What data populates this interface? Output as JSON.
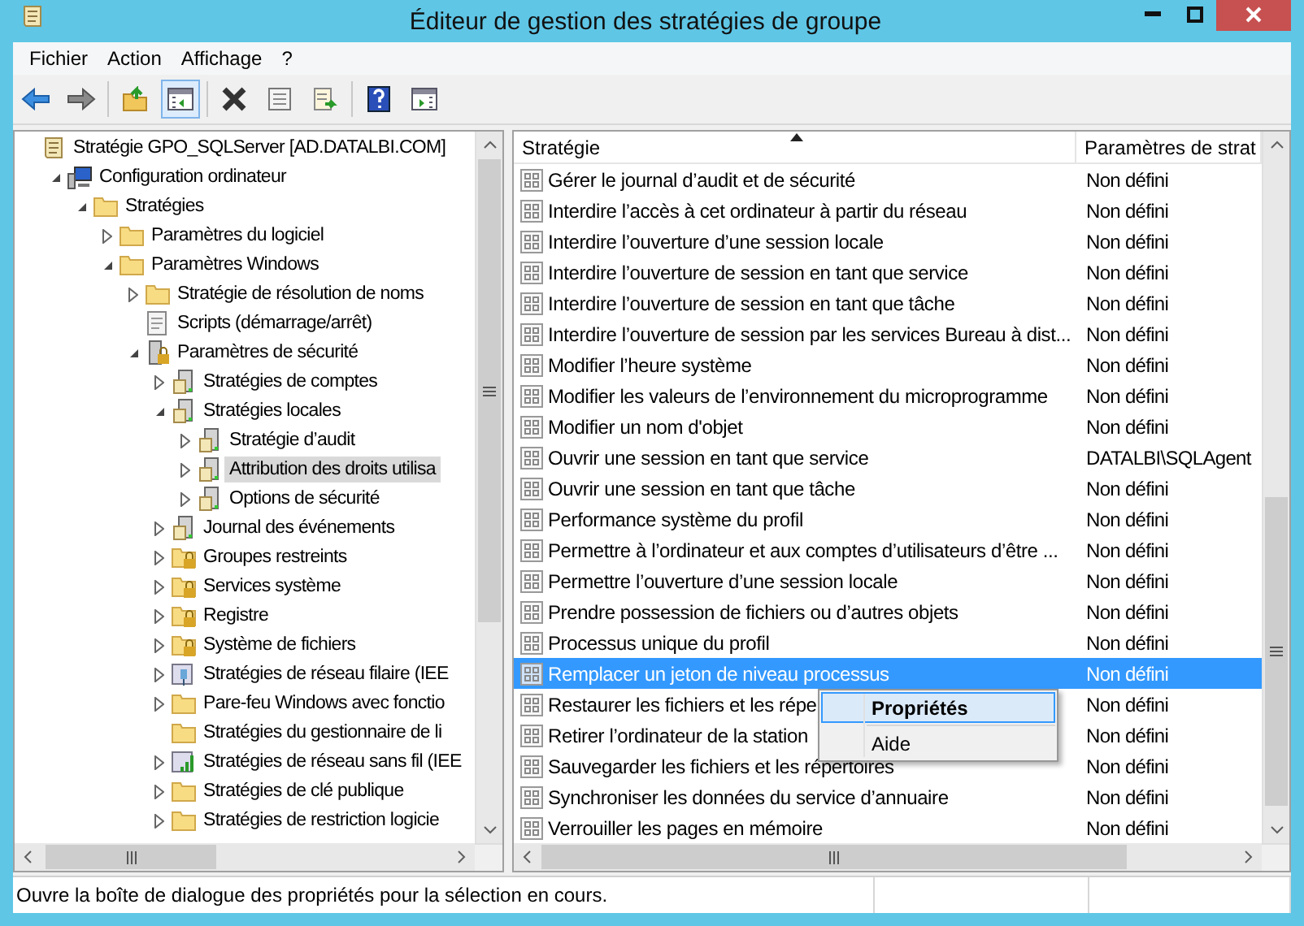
{
  "window": {
    "title": "Éditeur de gestion des stratégies de groupe"
  },
  "menu": [
    "Fichier",
    "Action",
    "Affichage",
    "?"
  ],
  "toolbar": [
    {
      "kind": "back"
    },
    {
      "kind": "forward"
    },
    {
      "kind": "sep"
    },
    {
      "kind": "up"
    },
    {
      "kind": "tree",
      "selected": true
    },
    {
      "kind": "sep"
    },
    {
      "kind": "delete"
    },
    {
      "kind": "properties"
    },
    {
      "kind": "export"
    },
    {
      "kind": "sep"
    },
    {
      "kind": "help"
    },
    {
      "kind": "pane",
      "selected": false
    }
  ],
  "tree": [
    {
      "label": "Stratégie GPO_SQLServer [AD.DATALBI.COM]",
      "kind": "scroll",
      "selected": false,
      "children": [
        {
          "label": "Configuration ordinateur",
          "kind": "computer",
          "expanded": true,
          "selected": false,
          "children": [
            {
              "label": "Stratégies",
              "kind": "folder",
              "expanded": true,
              "selected": false,
              "children": [
                {
                  "label": "Paramètres du logiciel",
                  "kind": "folder",
                  "expanded": false,
                  "selected": false
                },
                {
                  "label": "Paramètres Windows",
                  "kind": "folder",
                  "expanded": true,
                  "selected": false,
                  "children": [
                    {
                      "label": "Stratégie de résolution de noms",
                      "kind": "folder",
                      "expanded": false,
                      "selected": false
                    },
                    {
                      "label": "Scripts (démarrage/arrêt)",
                      "kind": "script",
                      "selected": false
                    },
                    {
                      "label": "Paramètres de sécurité",
                      "kind": "lockserver",
                      "expanded": true,
                      "selected": false,
                      "children": [
                        {
                          "label": "Stratégies de comptes",
                          "kind": "server",
                          "expanded": false,
                          "selected": false
                        },
                        {
                          "label": "Stratégies locales",
                          "kind": "server",
                          "expanded": true,
                          "selected": false,
                          "children": [
                            {
                              "label": "Stratégie d’audit",
                              "kind": "server",
                              "expanded": false,
                              "selected": false
                            },
                            {
                              "label": "Attribution des droits utilisa",
                              "kind": "server",
                              "expanded": false,
                              "selected": true
                            },
                            {
                              "label": "Options de sécurité",
                              "kind": "server",
                              "expanded": false,
                              "selected": false
                            }
                          ]
                        },
                        {
                          "label": "Journal des événements",
                          "kind": "server",
                          "expanded": false,
                          "selected": false
                        },
                        {
                          "label": "Groupes restreints",
                          "kind": "lockfolder",
                          "expanded": false,
                          "selected": false
                        },
                        {
                          "label": "Services système",
                          "kind": "lockfolder",
                          "expanded": false,
                          "selected": false
                        },
                        {
                          "label": "Registre",
                          "kind": "lockfolder",
                          "expanded": false,
                          "selected": false
                        },
                        {
                          "label": "Système de fichiers",
                          "kind": "lockfolder",
                          "expanded": false,
                          "selected": false
                        },
                        {
                          "label": "Stratégies de réseau filaire (IEE",
                          "kind": "network",
                          "expanded": false,
                          "selected": false
                        },
                        {
                          "label": "Pare-feu Windows avec fonctio",
                          "kind": "folder",
                          "expanded": false,
                          "selected": false
                        },
                        {
                          "label": "Stratégies du gestionnaire de li",
                          "kind": "folder",
                          "selected": false
                        },
                        {
                          "label": "Stratégies de réseau sans fil (IEE",
                          "kind": "wireless",
                          "expanded": false,
                          "selected": false
                        },
                        {
                          "label": "Stratégies de clé publique",
                          "kind": "folder",
                          "expanded": false,
                          "selected": false
                        },
                        {
                          "label": "Stratégies de restriction logicie",
                          "kind": "folder",
                          "expanded": false,
                          "selected": false
                        }
                      ]
                    }
                  ]
                }
              ]
            }
          ]
        }
      ]
    }
  ],
  "list": {
    "columns": [
      "Stratégie",
      "Paramètres de strat"
    ],
    "rows": [
      {
        "policy": "Gérer le journal d’audit et de sécurité",
        "setting": "Non défini",
        "selected": false
      },
      {
        "policy": "Interdire l’accès à cet ordinateur à partir du réseau",
        "setting": "Non défini",
        "selected": false
      },
      {
        "policy": "Interdire l’ouverture d’une session locale",
        "setting": "Non défini",
        "selected": false
      },
      {
        "policy": "Interdire l’ouverture de session en tant que service",
        "setting": "Non défini",
        "selected": false
      },
      {
        "policy": "Interdire l’ouverture de session en tant que tâche",
        "setting": "Non défini",
        "selected": false
      },
      {
        "policy": "Interdire l’ouverture de session par les services Bureau à dist...",
        "setting": "Non défini",
        "selected": false
      },
      {
        "policy": "Modifier l’heure système",
        "setting": "Non défini",
        "selected": false
      },
      {
        "policy": "Modifier les valeurs de l’environnement du microprogramme",
        "setting": "Non défini",
        "selected": false
      },
      {
        "policy": "Modifier un nom d'objet",
        "setting": "Non défini",
        "selected": false
      },
      {
        "policy": "Ouvrir une session en tant que service",
        "setting": "DATALBI\\SQLAgent",
        "selected": false
      },
      {
        "policy": "Ouvrir une session en tant que tâche",
        "setting": "Non défini",
        "selected": false
      },
      {
        "policy": "Performance système du profil",
        "setting": "Non défini",
        "selected": false
      },
      {
        "policy": "Permettre à l’ordinateur et aux comptes d’utilisateurs d’être ...",
        "setting": "Non défini",
        "selected": false
      },
      {
        "policy": "Permettre l’ouverture d’une session locale",
        "setting": "Non défini",
        "selected": false
      },
      {
        "policy": "Prendre possession de fichiers ou d’autres objets",
        "setting": "Non défini",
        "selected": false
      },
      {
        "policy": "Processus unique du profil",
        "setting": "Non défini",
        "selected": false
      },
      {
        "policy": "Remplacer un jeton de niveau processus",
        "setting": "Non défini",
        "selected": true
      },
      {
        "policy": "Restaurer les fichiers et les répe",
        "setting": "Non défini",
        "selected": false
      },
      {
        "policy": "Retirer l’ordinateur de la station",
        "setting": "Non défini",
        "selected": false
      },
      {
        "policy": "Sauvegarder les fichiers et les répertoires",
        "setting": "Non défini",
        "selected": false
      },
      {
        "policy": "Synchroniser les données du service d’annuaire",
        "setting": "Non défini",
        "selected": false
      },
      {
        "policy": "Verrouiller les pages en mémoire",
        "setting": "Non défini",
        "selected": false
      }
    ]
  },
  "context_menu": [
    {
      "kind": "item",
      "label": "Propriétés",
      "default": true,
      "selected": true
    },
    {
      "kind": "separator"
    },
    {
      "kind": "item",
      "label": "Aide",
      "default": false,
      "selected": false
    }
  ],
  "status_bar": "Ouvre la boîte de dialogue des propriétés pour la sélection en cours."
}
